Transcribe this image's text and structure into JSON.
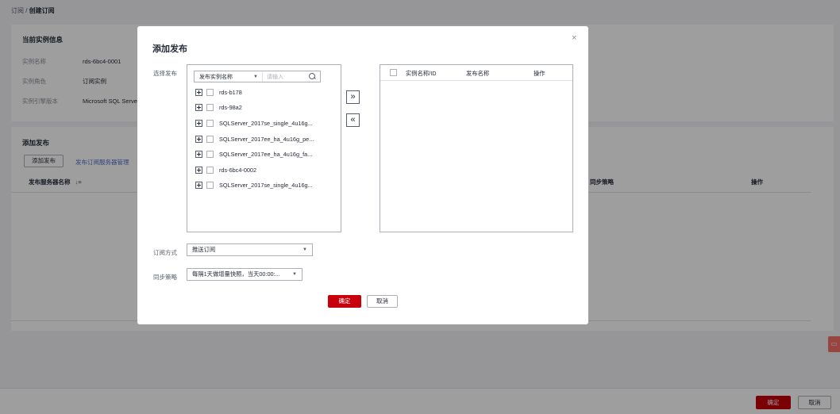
{
  "breadcrumb": {
    "parent": "订阅",
    "separator": " / ",
    "current": "创建订阅"
  },
  "instance_info": {
    "title": "当前实例信息",
    "rows": [
      {
        "key": "实例名称",
        "value": "rds-6bc4-0001"
      },
      {
        "key": "实例角色",
        "value": "订阅实例"
      },
      {
        "key": "实例引擎版本",
        "value": "Microsoft SQL Serve"
      }
    ]
  },
  "publish_section": {
    "title": "添加发布",
    "add_button": "添加发布",
    "link_text": "发布订阅服务器管理",
    "columns": {
      "server_name": "发布服务器名称",
      "strategy": "同步策略",
      "action": "操作"
    }
  },
  "footer": {
    "ok": "确定",
    "cancel": "取消"
  },
  "modal": {
    "title": "添加发布",
    "close_glyph": "×",
    "select_label": "选择发布",
    "filter_select": "发布实例名称",
    "filter_placeholder": "请输入",
    "tree_items": [
      "rds-b178",
      "rds-98a2",
      "SQLServer_2017se_single_4u16g...",
      "SQLServer_2017ee_ha_4u16g_pe...",
      "SQLServer_2017ee_ha_4u16g_fa...",
      "rds-6bc4-0002",
      "SQLServer_2017se_single_4u16g..."
    ],
    "move_right": "»",
    "move_left": "«",
    "target_columns": {
      "instance": "实例名称/ID",
      "publish": "发布名称",
      "action": "操作"
    },
    "subscribe_mode_label": "订阅方式",
    "subscribe_mode_value": "推送订阅",
    "sync_label": "同步策略",
    "sync_value": "每隔1天做增量快照，当天00:00:...",
    "ok": "确定",
    "cancel": "取消"
  },
  "colors": {
    "primary": "#c7000b",
    "link": "#526ecc",
    "overlay": "rgba(0,0,0,0.38)"
  },
  "icons": {
    "search": "search-icon",
    "expand": "plus-square-icon",
    "close": "close-icon",
    "sort": "sort-icon",
    "feedback": "feedback-icon"
  }
}
